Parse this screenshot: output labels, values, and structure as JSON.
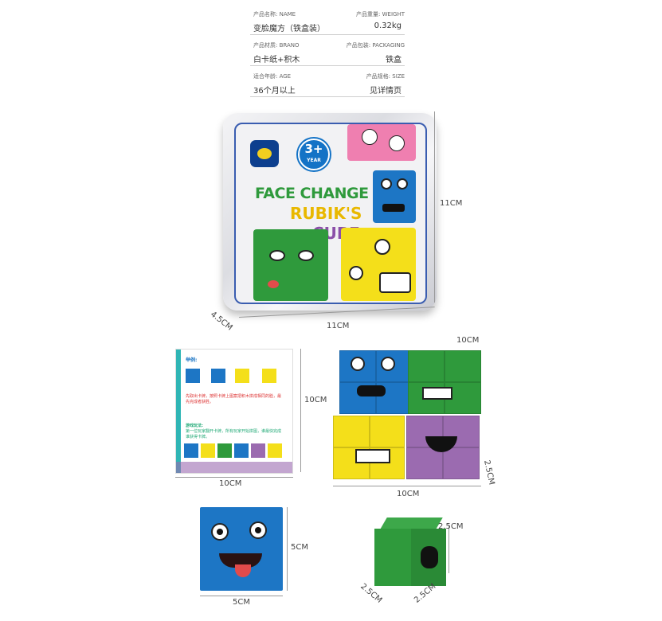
{
  "specs": [
    {
      "label": "产品名称: NAME",
      "value": "变脸魔方（铁盒装）"
    },
    {
      "label": "产品重量: WEIGHT",
      "value": "0.32kg"
    },
    {
      "label": "产品材质: BRANO",
      "value": "白卡纸+积木"
    },
    {
      "label": "产品包装: PACKAGING",
      "value": "铁盒"
    },
    {
      "label": "适合年龄: AGE",
      "value": "36个月以上"
    },
    {
      "label": "产品规格: SIZE",
      "value": "见详情页"
    }
  ],
  "tin": {
    "age_badge": "3+",
    "age_unit": "YEAR",
    "title_line1": "FACE CHANGE",
    "title_line2": "RUBIK'S",
    "title_line3": "CUBE"
  },
  "card": {
    "heading": "举例:",
    "text1": "先取出卡牌，按照卡牌上图案把积木拼成相同的脸，最先完成者获胜。",
    "text2": "游戏玩法:",
    "text3": "第一位玩家翻开卡牌，所有玩家开始拼图，谁最快完成谁获得卡牌。"
  },
  "dims": {
    "tin_height": "11CM",
    "tin_width": "11CM",
    "tin_depth": "4.5CM",
    "card_height": "10CM",
    "card_width": "10CM",
    "grid_top": "10CM",
    "grid_bottom": "10CM",
    "grid_depth": "2.5CM",
    "face_height": "5CM",
    "face_width": "5CM",
    "cube_right": "2.5CM",
    "cube_bottom_left": "2.5CM",
    "cube_bottom_right": "2.5CM"
  },
  "colors": {
    "blue": "#1d76c5",
    "green": "#2f9a3c",
    "yellow": "#f4df1a",
    "purple": "#9b6bb0",
    "pink": "#ef7fb0",
    "red": "#e24b4b"
  }
}
